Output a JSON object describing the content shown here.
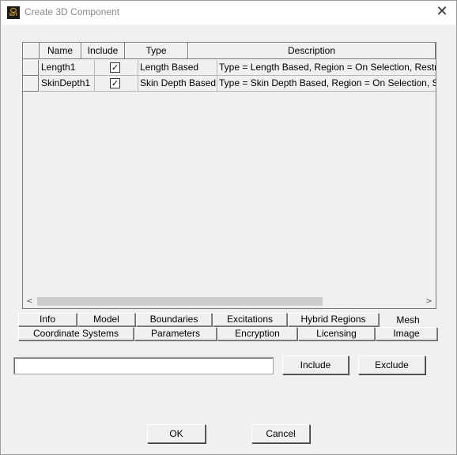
{
  "window": {
    "title": "Create 3D Component",
    "app_icon_label": "EDT",
    "close_glyph": "✕"
  },
  "table": {
    "columns": [
      "Name",
      "Include",
      "Type",
      "Description"
    ],
    "rows": [
      {
        "name": "Length1",
        "include": true,
        "type": "Length Based",
        "description": "Type = Length Based, Region = On Selection, Restrict Length"
      },
      {
        "name": "SkinDepth1",
        "include": true,
        "type": "Skin Depth Based",
        "description": "Type = Skin Depth Based, Region = On Selection, Skin Depth"
      }
    ],
    "check_glyph": "✓",
    "scroll_left_glyph": "<",
    "scroll_right_glyph": ">"
  },
  "tabs": {
    "row1": [
      "Info",
      "Model",
      "Boundaries",
      "Excitations",
      "Hybrid Regions",
      "Mesh"
    ],
    "row2": [
      "Coordinate Systems",
      "Parameters",
      "Encryption",
      "Licensing",
      "Image"
    ],
    "active": "Mesh"
  },
  "controls": {
    "text_value": "",
    "include_label": "Include",
    "exclude_label": "Exclude",
    "ok_label": "OK",
    "cancel_label": "Cancel"
  }
}
